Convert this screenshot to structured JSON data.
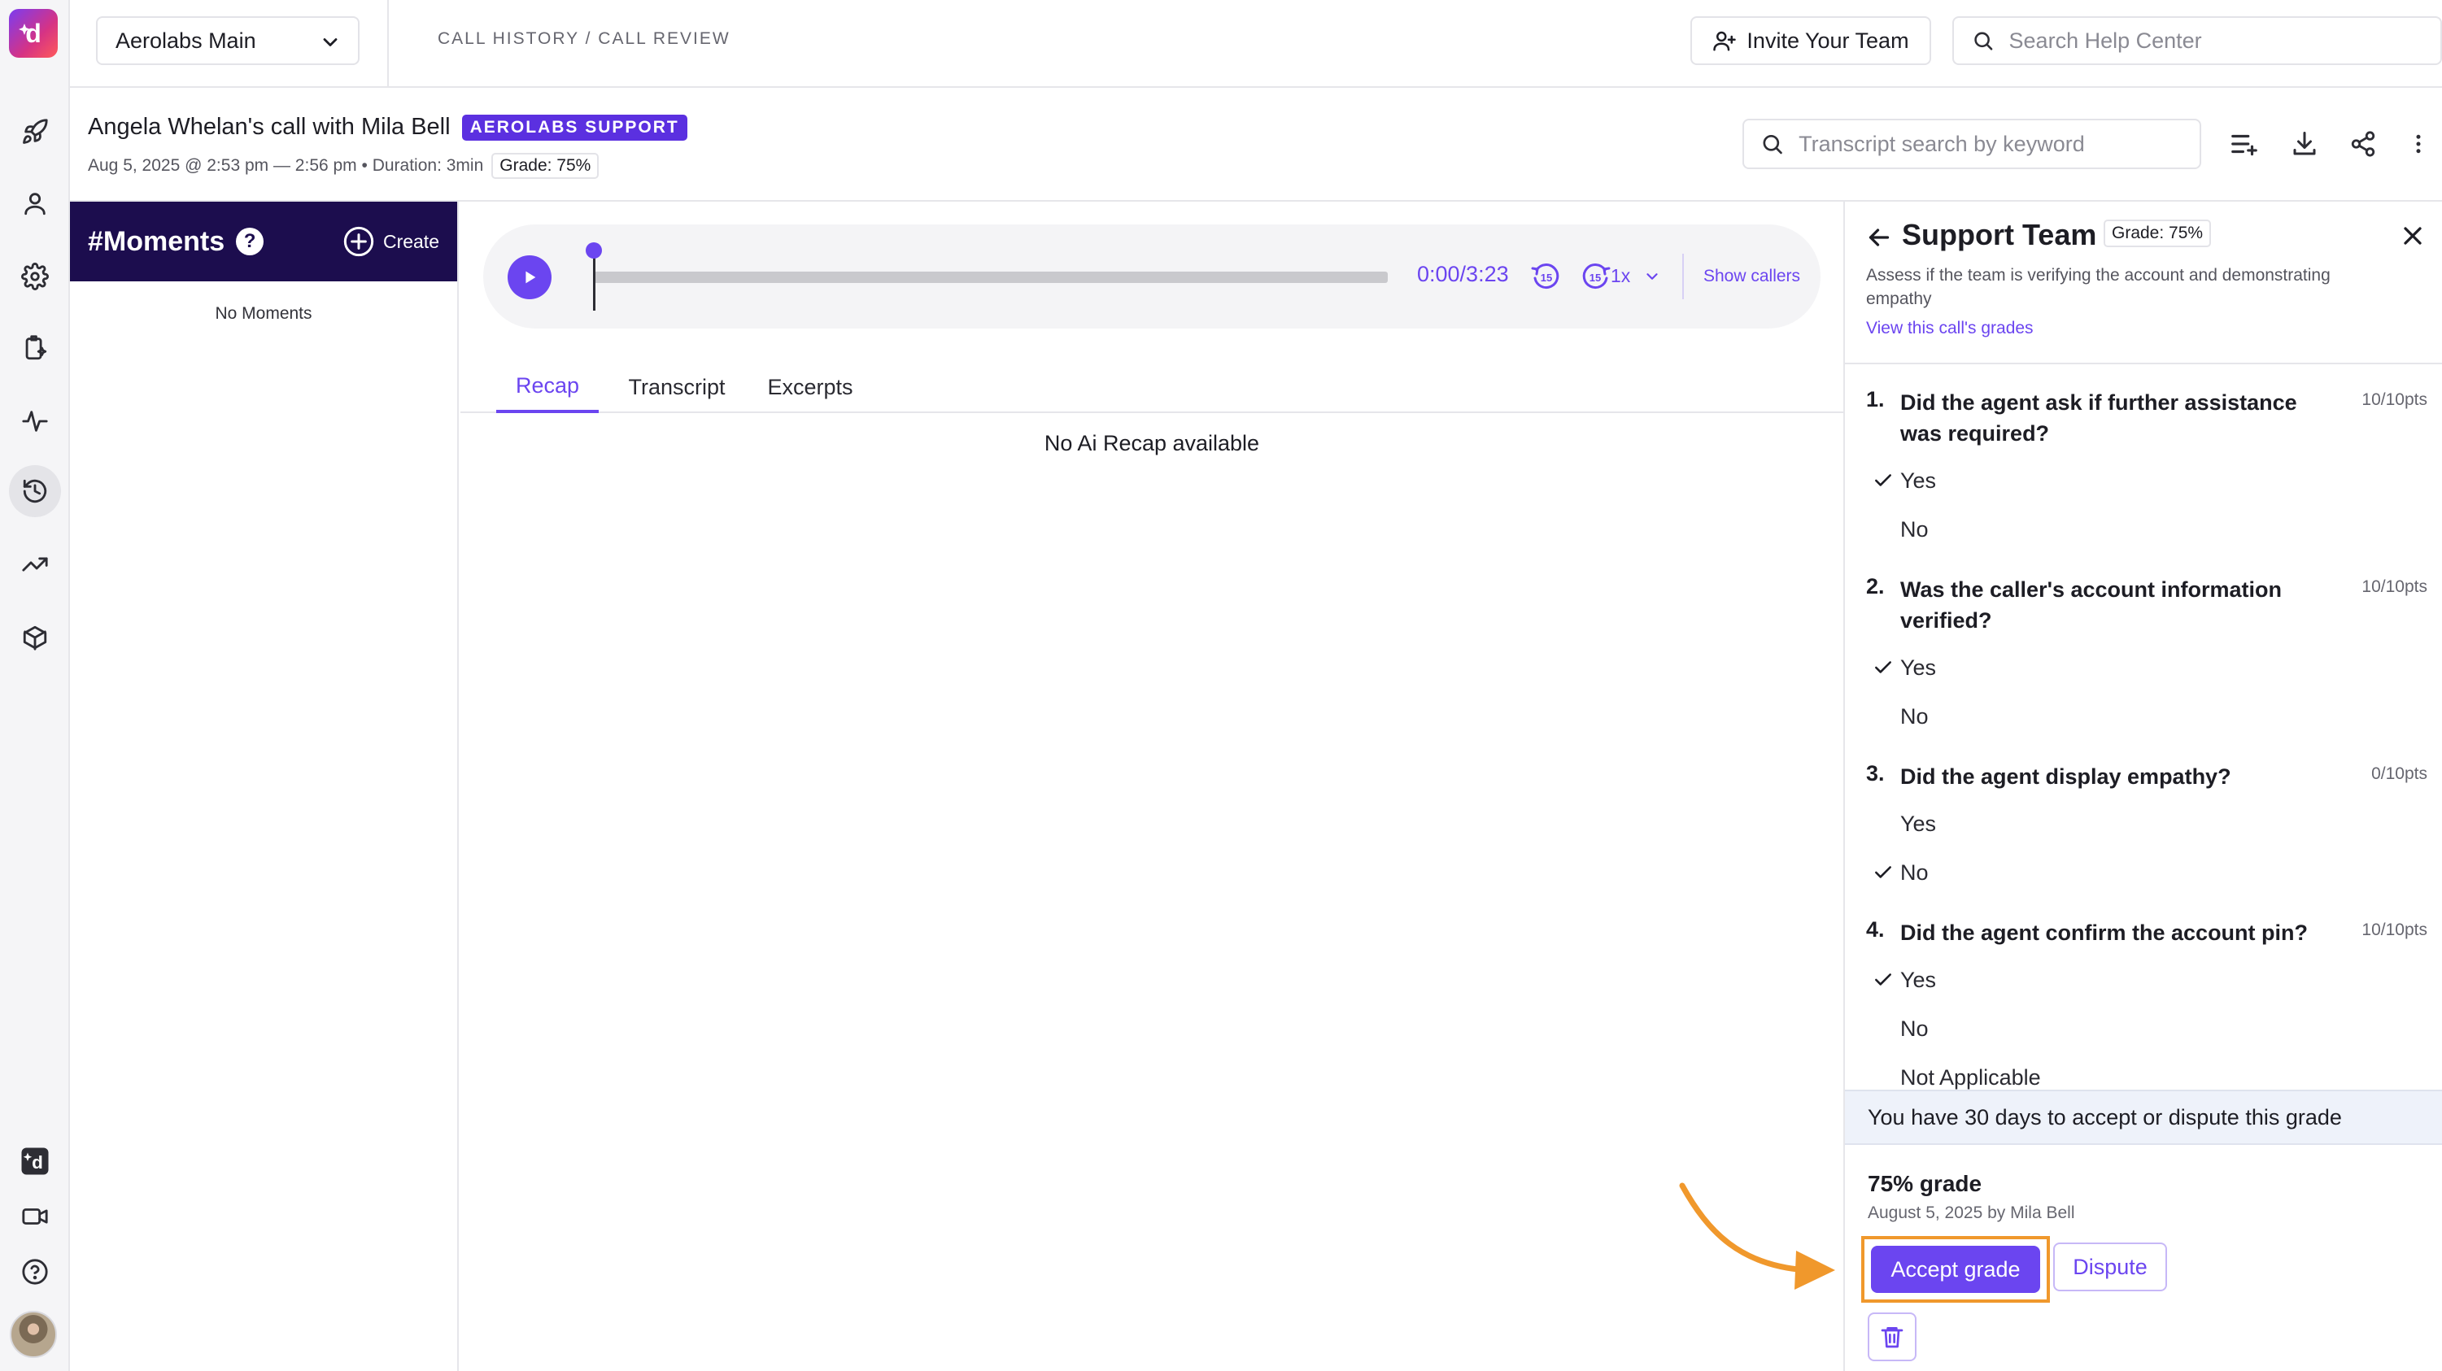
{
  "app": {
    "workspace": "Aerolabs Main",
    "breadcrumb": "CALL HISTORY / CALL REVIEW",
    "invite_label": "Invite Your Team",
    "help_search_placeholder": "Search Help Center",
    "accent": "#6b45f0"
  },
  "rail": {
    "icons": [
      "logo-icon",
      "rocket-icon",
      "user-icon",
      "gear-icon",
      "clipboard-sparkle-icon",
      "activity-icon",
      "history-icon",
      "trending-icon",
      "package-icon",
      "dialpad-icon",
      "video-icon",
      "help-icon",
      "avatar"
    ]
  },
  "call": {
    "title": "Angela Whelan's call with Mila Bell",
    "tag": "AEROLABS SUPPORT",
    "meta": "Aug 5, 2025 @ 2:53 pm — 2:56 pm • Duration: 3min",
    "grade": "Grade: 75%",
    "transcript_search_placeholder": "Transcript search by keyword"
  },
  "moments": {
    "title": "#Moments",
    "help": "?",
    "create_label": "Create",
    "empty_label": "No Moments"
  },
  "player": {
    "time": "0:00/3:23",
    "back_skip": "15",
    "forward_skip": "15",
    "speed": "1x",
    "show_callers": "Show callers",
    "progress": 0
  },
  "tabs": [
    {
      "label": "Recap",
      "active": true
    },
    {
      "label": "Transcript",
      "active": false
    },
    {
      "label": "Excerpts",
      "active": false
    }
  ],
  "recap": {
    "empty_label": "No Ai Recap available"
  },
  "scorecard": {
    "title": "Support Team",
    "grade": "Grade: 75%",
    "description": "Assess if the team is verifying the account and demonstrating empathy",
    "link": "View this call's grades",
    "questions": [
      {
        "num": "1.",
        "text": "Did the agent ask if further assistance was required?",
        "points": "10/10pts",
        "options": [
          {
            "label": "Yes",
            "selected": true
          },
          {
            "label": "No",
            "selected": false
          }
        ]
      },
      {
        "num": "2.",
        "text": "Was the caller's account information verified?",
        "points": "10/10pts",
        "options": [
          {
            "label": "Yes",
            "selected": true
          },
          {
            "label": "No",
            "selected": false
          }
        ]
      },
      {
        "num": "3.",
        "text": "Did the agent display empathy?",
        "points": "0/10pts",
        "options": [
          {
            "label": "Yes",
            "selected": false
          },
          {
            "label": "No",
            "selected": true
          }
        ]
      },
      {
        "num": "4.",
        "text": "Did the agent confirm the account pin?",
        "points": "10/10pts",
        "options": [
          {
            "label": "Yes",
            "selected": true
          },
          {
            "label": "No",
            "selected": false
          },
          {
            "label": "Not Applicable",
            "selected": false
          }
        ]
      }
    ],
    "notice": "You have 30 days to accept or dispute this grade",
    "summary_grade": "75% grade",
    "summary_date": "August 5, 2025 by Mila Bell",
    "accept_label": "Accept grade",
    "dispute_label": "Dispute",
    "highlight_color": "#f0982c"
  }
}
